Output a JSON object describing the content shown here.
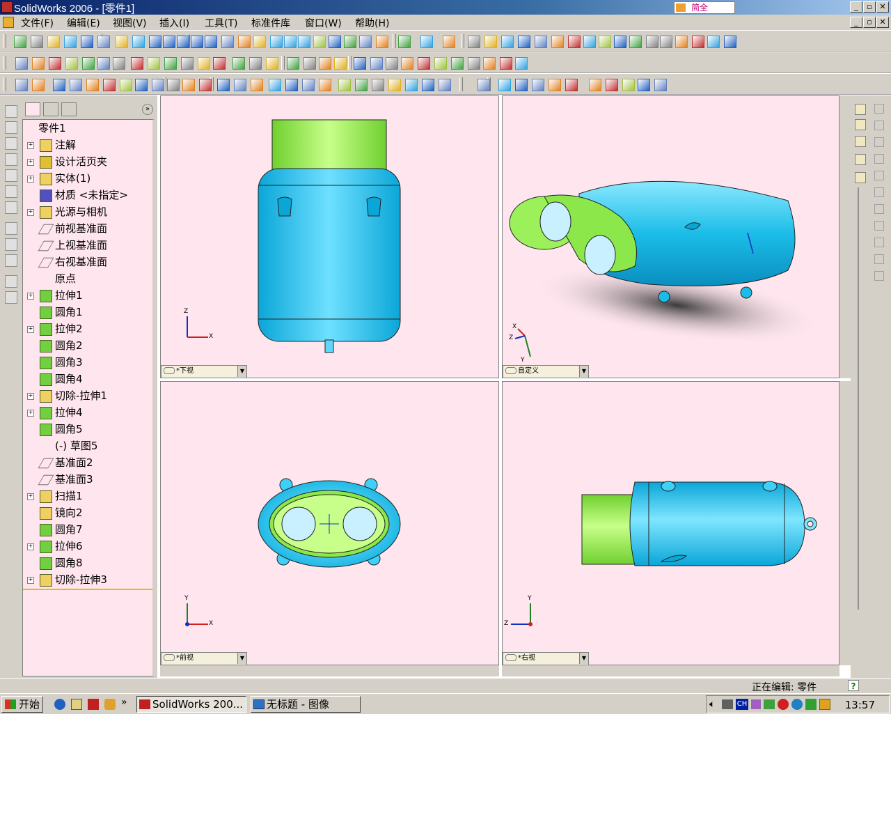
{
  "window": {
    "title": "SolidWorks 2006 - [零件1]",
    "ime_text": "简全",
    "buttons": [
      "_",
      "▫",
      "✕"
    ]
  },
  "menu": [
    "文件(F)",
    "编辑(E)",
    "视图(V)",
    "插入(I)",
    "工具(T)",
    "标准件库",
    "窗口(W)",
    "帮助(H)"
  ],
  "tree": {
    "root": "零件1",
    "items": [
      {
        "label": "注解",
        "icon": "annotation-icon",
        "expand": true
      },
      {
        "label": "设计活页夹",
        "icon": "design-binder-icon",
        "expand": true
      },
      {
        "label": "实体(1)",
        "icon": "solid-bodies-folder-icon",
        "expand": true
      },
      {
        "label": "材质 <未指定>",
        "icon": "material-icon",
        "expand": false
      },
      {
        "label": "光源与相机",
        "icon": "lights-cameras-icon",
        "expand": true
      },
      {
        "label": "前视基准面",
        "icon": "plane-icon",
        "expand": false
      },
      {
        "label": "上视基准面",
        "icon": "plane-icon",
        "expand": false
      },
      {
        "label": "右视基准面",
        "icon": "plane-icon",
        "expand": false
      },
      {
        "label": "原点",
        "icon": "origin-icon",
        "expand": false
      },
      {
        "label": "拉伸1",
        "icon": "extrude-icon",
        "expand": true
      },
      {
        "label": "圆角1",
        "icon": "fillet-icon",
        "expand": false
      },
      {
        "label": "拉伸2",
        "icon": "extrude-icon",
        "expand": true
      },
      {
        "label": "圆角2",
        "icon": "fillet-icon",
        "expand": false
      },
      {
        "label": "圆角3",
        "icon": "fillet-icon",
        "expand": false
      },
      {
        "label": "圆角4",
        "icon": "fillet-icon",
        "expand": false
      },
      {
        "label": "切除-拉伸1",
        "icon": "cut-extrude-icon",
        "expand": true
      },
      {
        "label": "拉伸4",
        "icon": "extrude-icon",
        "expand": true
      },
      {
        "label": "圆角5",
        "icon": "fillet-icon",
        "expand": false
      },
      {
        "label": "(-) 草图5",
        "icon": "sketch-icon",
        "expand": false
      },
      {
        "label": "基准面2",
        "icon": "plane-icon",
        "expand": false
      },
      {
        "label": "基准面3",
        "icon": "plane-icon",
        "expand": false
      },
      {
        "label": "扫描1",
        "icon": "sweep-icon",
        "expand": true
      },
      {
        "label": "镜向2",
        "icon": "mirror-icon",
        "expand": false
      },
      {
        "label": "圆角7",
        "icon": "fillet-icon",
        "expand": false
      },
      {
        "label": "拉伸6",
        "icon": "extrude-icon",
        "expand": true
      },
      {
        "label": "圆角8",
        "icon": "fillet-icon",
        "expand": false
      },
      {
        "label": "切除-拉伸3",
        "icon": "cut-extrude-icon",
        "expand": true
      }
    ]
  },
  "viewports": {
    "top_left": {
      "view": "*下视",
      "axes": [
        "Z",
        "X"
      ]
    },
    "top_right": {
      "view": "自定义",
      "axes": [
        "X",
        "Z",
        "Y"
      ]
    },
    "bottom_left": {
      "view": "*前视",
      "axes": [
        "Y",
        "X"
      ]
    },
    "bottom_right": {
      "view": "*右视",
      "axes": [
        "Y",
        "Z"
      ]
    }
  },
  "status": {
    "text": "正在编辑: 零件",
    "help": "?"
  },
  "taskbar": {
    "start": "开始",
    "tasks": [
      "SolidWorks 200...",
      "无标题 - 图像"
    ],
    "tray_lang": "CH",
    "clock": "13:57",
    "more": "»"
  },
  "colors": {
    "viewport_bg": "#ffe6ee",
    "body_cyan": "#22c8f0",
    "body_green": "#8ce84a",
    "titlebar": "#0a246a"
  }
}
